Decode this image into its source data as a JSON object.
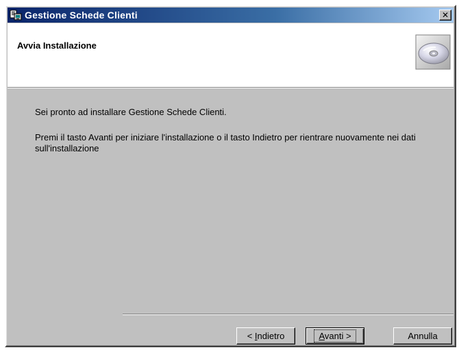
{
  "window": {
    "title": "Gestione Schede Clienti",
    "icon": "installer-icon",
    "close_glyph": "✕"
  },
  "header": {
    "title": "Avvia Installazione",
    "icon": "cd-icon"
  },
  "content": {
    "message1": "Sei pronto ad installare Gestione Schede Clienti.",
    "message2": "Premi il tasto Avanti per iniziare l'installazione o il tasto Indietro per rientrare nuovamente nei dati sull'installazione"
  },
  "buttons": {
    "back_prefix": "< ",
    "back_accel": "I",
    "back_rest": "ndietro",
    "next_accel": "A",
    "next_rest": "vanti >",
    "cancel": "Annulla"
  },
  "colors": {
    "titlebar_start": "#0a246a",
    "titlebar_end": "#a6caf0",
    "dialog_face": "#c0c0c0"
  }
}
